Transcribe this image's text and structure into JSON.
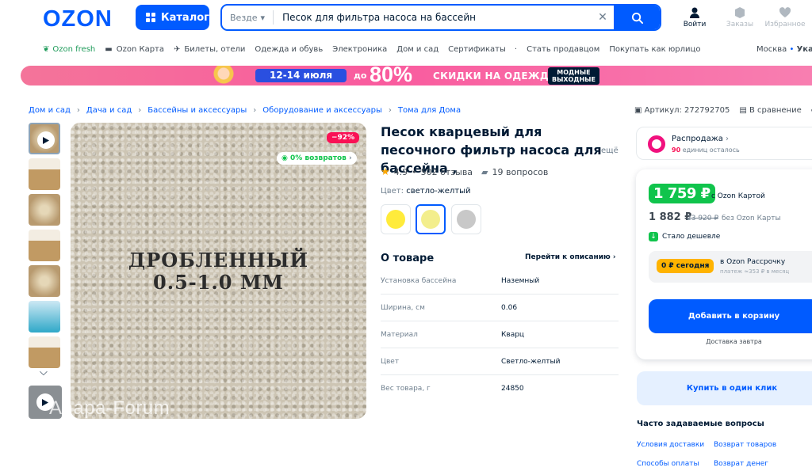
{
  "header": {
    "logo": "OZON",
    "catalog_label": "Каталог",
    "search": {
      "scope": "Везде",
      "value": "Песок для фильтра насоса на бассейн"
    },
    "icons": [
      {
        "label": "Войти",
        "icon": "user-icon"
      },
      {
        "label": "Заказы",
        "icon": "box-icon"
      },
      {
        "label": "Избранное",
        "icon": "heart-icon"
      }
    ]
  },
  "nav": {
    "items": [
      "Ozon fresh",
      "Ozon Карта",
      "Билеты, отели",
      "Одежда и обувь",
      "Электроника",
      "Дом и сад",
      "Сертификаты",
      "Стать продавцом",
      "Покупать как юрлицо"
    ],
    "city": "Москва",
    "city_more": "Укаж"
  },
  "banner": {
    "dates": "12-14 июля",
    "prefix": "до",
    "percent": "80%",
    "text": "СКИДКИ НА ОДЕЖДУ",
    "badge_line1": "МОДНЫЕ",
    "badge_line2": "ВЫХОДНЫЕ"
  },
  "breadcrumbs": [
    "Дом и сад",
    "Дача и сад",
    "Бассейны и аксессуары",
    "Оборудование и аксессуары",
    "Тома для Дома"
  ],
  "top_actions": {
    "article": "Артикул: 272792705",
    "compare": "В сравнение"
  },
  "gallery": {
    "overlay_line1": "ДРОБЛЕННЫЙ",
    "overlay_line2": "0.5-1.0 ММ",
    "discount": "−92%",
    "returns": "0% возвратов",
    "watermark": "Anapa-Forum"
  },
  "product": {
    "title": "Песок кварцевый для песочного фильтр насоса для бассейна ,",
    "title_more": "ещё",
    "rating": "4.9",
    "reviews": "502 отзыва",
    "questions": "19 вопросов",
    "color_label": "Цвет:",
    "color_value": "светло-желтый",
    "swatches": [
      "#ffeb3b",
      "#f3ee8c",
      "#c8c8c8"
    ]
  },
  "about": {
    "title": "О товаре",
    "to_description": "Перейти к описанию",
    "specs": [
      {
        "k": "Установка бассейна",
        "v": "Наземный"
      },
      {
        "k": "Ширина, см",
        "v": "0.06"
      },
      {
        "k": "Материал",
        "v": "Кварц"
      },
      {
        "k": "Цвет",
        "v": "Светло-желтый"
      },
      {
        "k": "Вес товара, г",
        "v": "24850"
      }
    ]
  },
  "seller": {
    "name": "Распродажа",
    "stock_count": "90",
    "stock_text": "единиц осталось"
  },
  "pricing": {
    "card_price": "1 759 ₽",
    "card_label": "с Ozon Картой",
    "price": "1 882 ₽",
    "old_price": "23 920 ₽",
    "no_card_label": "без Ozon Карты",
    "cheaper": "Стало дешевле",
    "install_badge": "0 ₽ сегодня",
    "install_line1": "в Ozon Рассрочку",
    "install_line2": "платеж ≈353 ₽ в месяц",
    "cart_button": "Добавить в корзину",
    "delivery": "Доставка завтра",
    "one_click": "Купить в один клик"
  },
  "faq": {
    "title": "Часто задаваемые вопросы",
    "links": [
      "Условия доставки",
      "Возврат товаров",
      "Способы оплаты",
      "Возврат денег"
    ]
  },
  "colors": {
    "brand": "#005bff",
    "green": "#10c44c",
    "pink": "#f91155",
    "text": "#001a34"
  }
}
